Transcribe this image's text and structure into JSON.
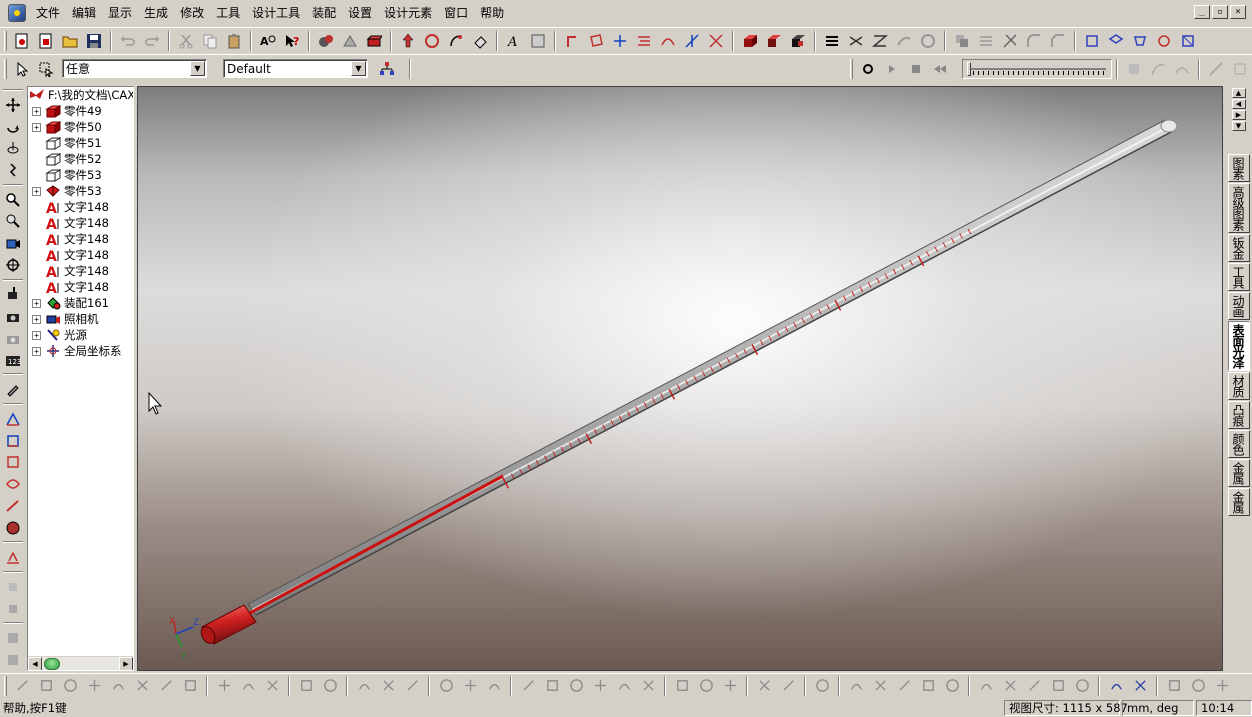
{
  "menu": [
    "文件",
    "编辑",
    "显示",
    "生成",
    "修改",
    "工具",
    "设计工具",
    "装配",
    "设置",
    "设计元素",
    "窗口",
    "帮助"
  ],
  "window_controls": [
    "_",
    "▫",
    "×"
  ],
  "toolbar2": {
    "filter_value": "任意",
    "style_value": "Default"
  },
  "tree": {
    "root": "F:\\我的文档\\CAX",
    "items": [
      {
        "label": "零件49",
        "icon": "part-solid-icon",
        "expandable": true
      },
      {
        "label": "零件50",
        "icon": "part-solid-icon",
        "expandable": true
      },
      {
        "label": "零件51",
        "icon": "part-outline-icon",
        "expandable": false
      },
      {
        "label": "零件52",
        "icon": "part-outline-icon",
        "expandable": false
      },
      {
        "label": "零件53",
        "icon": "part-outline-icon",
        "expandable": false
      },
      {
        "label": "零件53",
        "icon": "part-red-icon",
        "expandable": true
      },
      {
        "label": "文字148",
        "icon": "text-icon",
        "expandable": false
      },
      {
        "label": "文字148",
        "icon": "text-icon",
        "expandable": false
      },
      {
        "label": "文字148",
        "icon": "text-icon",
        "expandable": false
      },
      {
        "label": "文字148",
        "icon": "text-icon",
        "expandable": false
      },
      {
        "label": "文字148",
        "icon": "text-icon",
        "expandable": false
      },
      {
        "label": "文字148",
        "icon": "text-icon",
        "expandable": false
      },
      {
        "label": "装配161",
        "icon": "assembly-icon",
        "expandable": true
      },
      {
        "label": "照相机",
        "icon": "camera-icon",
        "expandable": true
      },
      {
        "label": "光源",
        "icon": "light-icon",
        "expandable": true
      },
      {
        "label": "全局坐标系",
        "icon": "coordinate-system-icon",
        "expandable": true
      }
    ]
  },
  "right_tabs": [
    {
      "label": "图素",
      "active": false
    },
    {
      "label": "高级图素",
      "active": false
    },
    {
      "label": "钣金",
      "active": false
    },
    {
      "label": "工具",
      "active": false
    },
    {
      "label": "动画",
      "active": false
    },
    {
      "label": "表面光泽",
      "active": true
    },
    {
      "label": "材质",
      "active": false
    },
    {
      "label": "凸痕",
      "active": false
    },
    {
      "label": "颜色",
      "active": false
    },
    {
      "label": "金属",
      "active": false
    },
    {
      "label": "金属",
      "active": false
    }
  ],
  "axis_labels": {
    "x": "X",
    "y": "Y",
    "z": "Z"
  },
  "status": {
    "help": "帮助,按F1键",
    "view_size": "视图尺寸: 1115 x  587",
    "units": "mm, deg",
    "time": "10:14"
  },
  "colors": {
    "accent_red": "#cc1010",
    "tube_gray": "#c8c8c8"
  }
}
